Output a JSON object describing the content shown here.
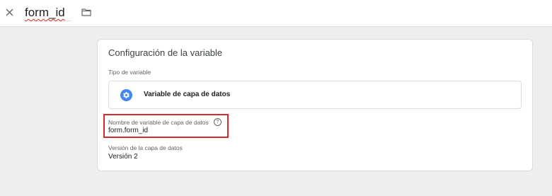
{
  "header": {
    "close_icon": "close-icon",
    "title": "form_id",
    "folder_icon": "folder-icon"
  },
  "card": {
    "title": "Configuración de la variable",
    "variable_type": {
      "label": "Tipo de variable",
      "icon": "settings-gear-icon",
      "value": "Variable de capa de datos"
    },
    "data_layer_name": {
      "label": "Nombre de variable de capa de datos",
      "help_icon": "help-icon",
      "value": "form.form_id"
    },
    "data_layer_version": {
      "label": "Versión de la capa de datos",
      "value": "Versión 2"
    }
  },
  "colors": {
    "accent": "#4285f4",
    "highlight_border": "#d52b2b",
    "spellcheck_underline": "#d93025"
  }
}
